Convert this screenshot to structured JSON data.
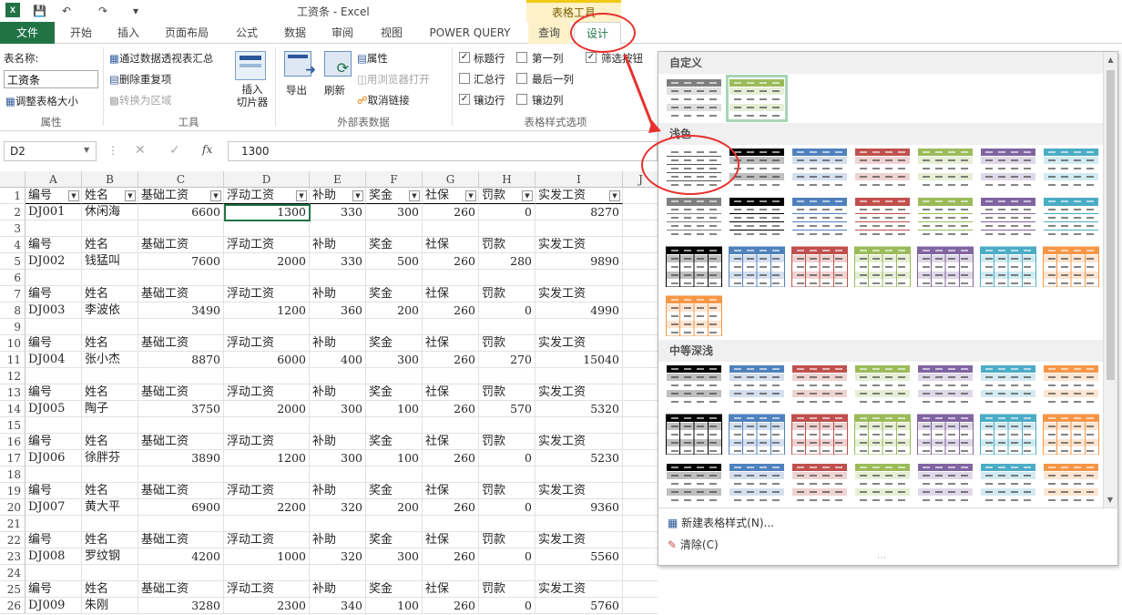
{
  "titlebar": {
    "title": "工资条 - Excel",
    "context_title": "表格工具",
    "logo": "X"
  },
  "tabs": [
    "文件",
    "开始",
    "插入",
    "页面布局",
    "公式",
    "数据",
    "审阅",
    "视图",
    "POWER QUERY",
    "查询",
    "设计"
  ],
  "ribbon": {
    "props": {
      "name_label": "表名称:",
      "name_value": "工资条",
      "resize": "调整表格大小",
      "group": "属性"
    },
    "tools": {
      "pivot": "通过数据透视表汇总",
      "dedupe": "删除重复项",
      "convert": "转换为区域",
      "slicer": "插入\n切片器",
      "group": "工具"
    },
    "external": {
      "export": "导出",
      "refresh": "刷新",
      "properties": "属性",
      "open_browser": "用浏览器打开",
      "unlink": "取消链接",
      "group": "外部表数据"
    },
    "style_options": {
      "header_row": "标题行",
      "total_row": "汇总行",
      "banded_rows": "镶边行",
      "first_col": "第一列",
      "last_col": "最后一列",
      "banded_cols": "镶边列",
      "filter_btn": "筛选按钮",
      "group": "表格样式选项"
    }
  },
  "formula": {
    "namebox": "D2",
    "value": "1300",
    "fx": "fx"
  },
  "grid": {
    "cols": [
      "A",
      "B",
      "C",
      "D",
      "E",
      "F",
      "G",
      "H",
      "I"
    ],
    "header": [
      "编号",
      "姓名",
      "基础工资",
      "浮动工资",
      "补助",
      "奖金",
      "社保",
      "罚款",
      "实发工资"
    ],
    "records": [
      [
        "DJ001",
        "休闲海",
        "6600",
        "1300",
        "330",
        "300",
        "260",
        "0",
        "8270"
      ],
      [
        "DJ002",
        "钱猛叫",
        "7600",
        "2000",
        "330",
        "500",
        "260",
        "280",
        "9890"
      ],
      [
        "DJ003",
        "李波依",
        "3490",
        "1200",
        "360",
        "200",
        "260",
        "0",
        "4990"
      ],
      [
        "DJ004",
        "张小杰",
        "8870",
        "6000",
        "400",
        "300",
        "260",
        "270",
        "15040"
      ],
      [
        "DJ005",
        "陶子",
        "3750",
        "2000",
        "300",
        "100",
        "260",
        "570",
        "5320"
      ],
      [
        "DJ006",
        "徐胖芬",
        "3890",
        "1200",
        "300",
        "100",
        "260",
        "0",
        "5230"
      ],
      [
        "DJ007",
        "黄大平",
        "6900",
        "2200",
        "320",
        "200",
        "260",
        "0",
        "9360"
      ],
      [
        "DJ008",
        "罗纹钢",
        "4200",
        "1000",
        "320",
        "300",
        "260",
        "0",
        "5560"
      ],
      [
        "DJ009",
        "朱刚",
        "3280",
        "2300",
        "340",
        "100",
        "260",
        "0",
        "5760"
      ]
    ],
    "row_numbers": [
      "1",
      "2",
      "3",
      "4",
      "5",
      "6",
      "7",
      "8",
      "9",
      "10",
      "11",
      "12",
      "13",
      "14",
      "15",
      "16",
      "17",
      "18",
      "19",
      "20",
      "21",
      "22",
      "23",
      "24",
      "25",
      "26"
    ],
    "cut_header": "J"
  },
  "gallery": {
    "custom": "自定义",
    "light": "浅色",
    "medium": "中等深浅",
    "new_style": "新建表格样式(N)...",
    "clear": "清除(C)",
    "colors": [
      "#7f7f7f",
      "#000000",
      "#4f81bd",
      "#c0504d",
      "#9bbb59",
      "#8064a2",
      "#4bacc6",
      "#f79646"
    ]
  }
}
